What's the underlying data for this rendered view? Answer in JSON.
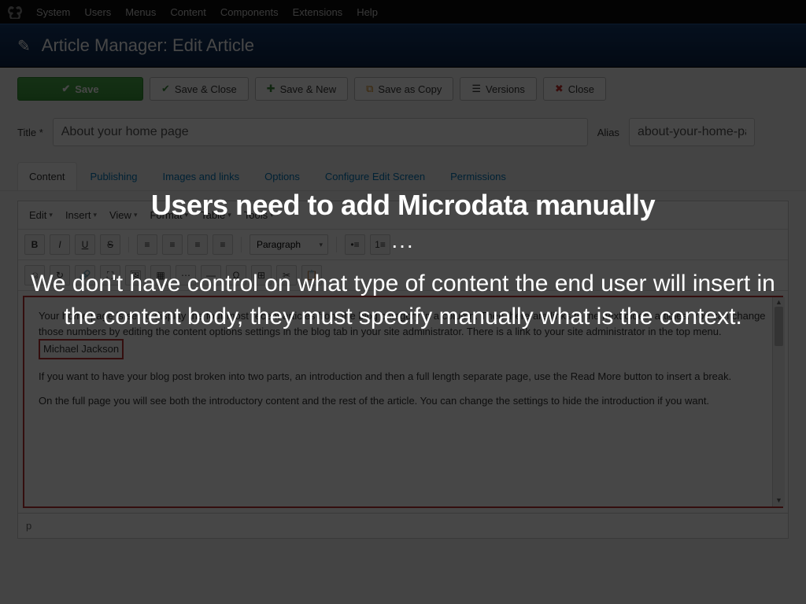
{
  "topnav": {
    "items": [
      "System",
      "Users",
      "Menus",
      "Content",
      "Components",
      "Extensions",
      "Help"
    ]
  },
  "header": {
    "title": "Article Manager: Edit Article"
  },
  "toolbar": {
    "save": "Save",
    "save_close": "Save & Close",
    "save_new": "Save & New",
    "save_copy": "Save as Copy",
    "versions": "Versions",
    "close": "Close"
  },
  "fields": {
    "title_label": "Title *",
    "title_value": "About your home page",
    "alias_label": "Alias",
    "alias_value": "about-your-home-page"
  },
  "tabs": [
    "Content",
    "Publishing",
    "Images and links",
    "Options",
    "Configure Edit Screen",
    "Permissions"
  ],
  "editor_menus": [
    "Edit",
    "Insert",
    "View",
    "Format",
    "Table",
    "Tools"
  ],
  "editor_format_select": "Paragraph",
  "article_body": {
    "p1a": "Your home page is set to display the four most recent articles from the blog category in a column. Then there are links to the next oldest articles. You can change those numbers by editing the content options settings in the blog tab in your site administrator. There is a link to your site administrator in the top menu. ",
    "p1_highlight": "Michael Jackson",
    "p2": "If you want to have your blog post broken into two parts, an introduction and then a full length separate page, use the Read More button to insert a break.",
    "p3": "On the full page you will see both the introductory content and the rest of the article. You can change the settings to hide the introduction if you want."
  },
  "pathbar": "p",
  "overlay": {
    "headline": "Users need to add Microdata manually",
    "dots": "...",
    "body": "We don't have control on what type of content the end user will insert in the content body, they must specify manually what is the context."
  }
}
